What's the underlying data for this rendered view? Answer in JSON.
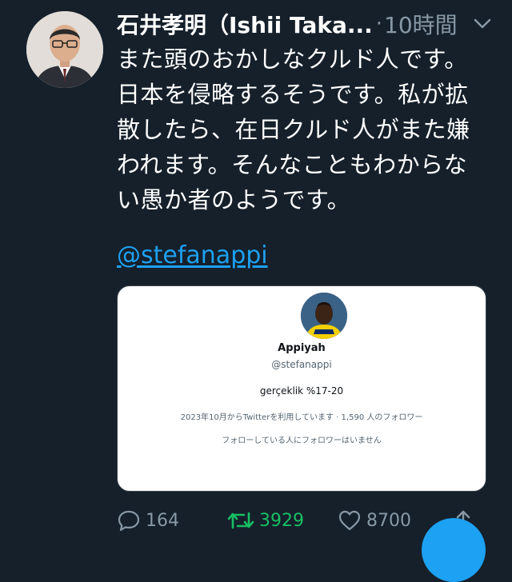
{
  "tweet": {
    "author_name": "石井孝明（Ishii Taka...",
    "separator": "·",
    "time": "10時間",
    "text_lines": [
      "また頭のおかしなクルド人です。",
      "日本を侵略するそうです。私が拡",
      "散したら、在日クルド人がまた嫌",
      "われます。そんなこともわからな",
      "い愚か者のようです。"
    ],
    "mention": "@stefanappi"
  },
  "card": {
    "name": "Appiyah",
    "handle": "@stefanappi",
    "bio": "gerçeklik %17-20",
    "meta": "2023年10月からTwitterを利用しています · 1,590 人のフォロワー",
    "follow_note": "フォローしている人にフォロワーはいません"
  },
  "actions": {
    "replies": "164",
    "retweets": "3929",
    "likes": "8700"
  },
  "icons": {
    "reply": "reply-icon",
    "retweet": "retweet-icon",
    "like": "heart-icon",
    "share": "share-icon",
    "menu": "chevron-down-icon"
  },
  "colors": {
    "background": "#15202b",
    "accent": "#1da1f2",
    "retweet": "#17bf63",
    "muted": "#8899a6"
  }
}
